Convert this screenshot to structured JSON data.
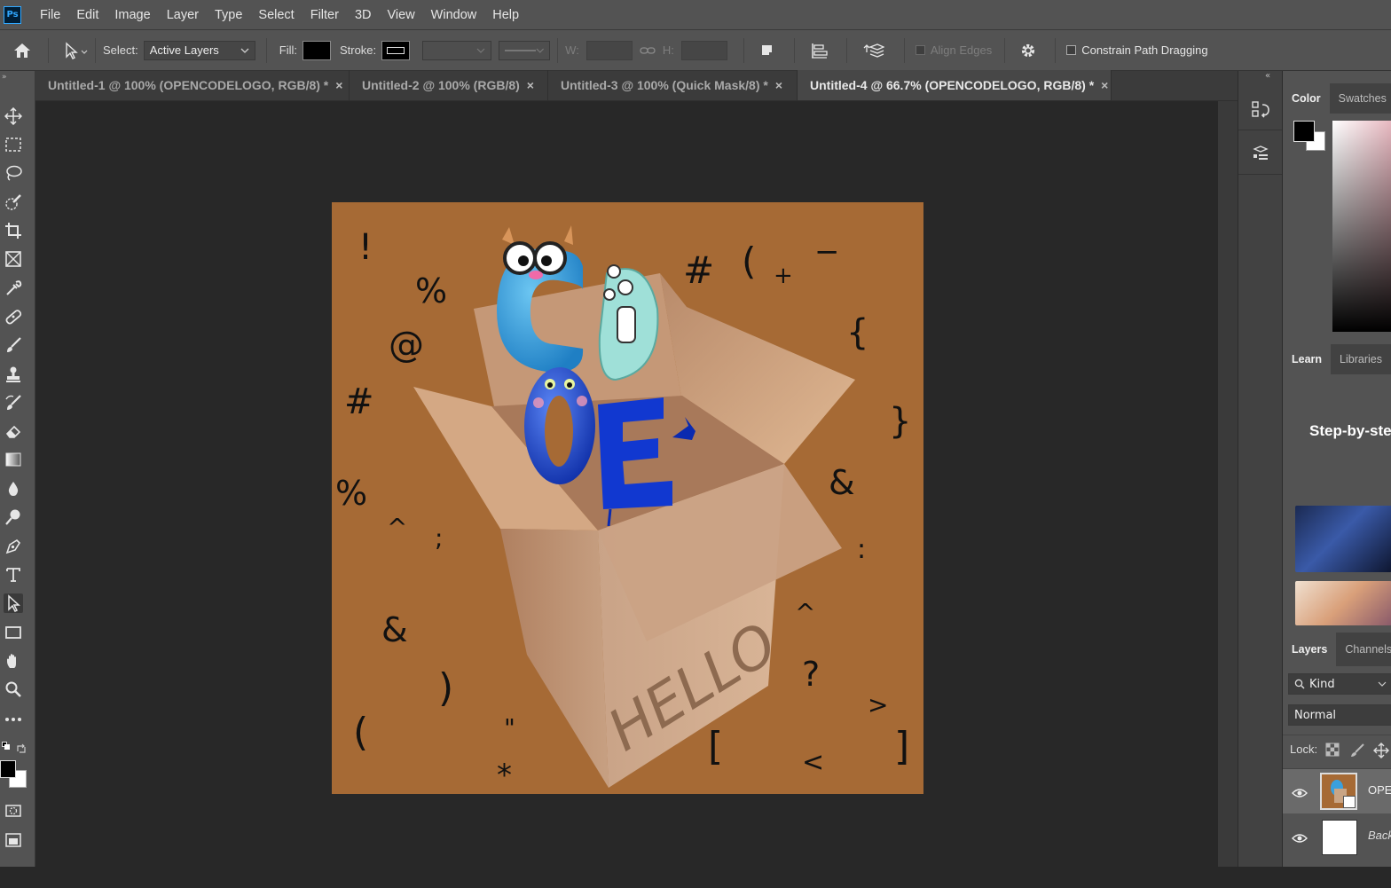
{
  "app": {
    "logo_text": "Ps"
  },
  "menu": [
    "File",
    "Edit",
    "Image",
    "Layer",
    "Type",
    "Select",
    "Filter",
    "3D",
    "View",
    "Window",
    "Help"
  ],
  "options": {
    "select_label": "Select:",
    "select_value": "Active Layers",
    "fill_label": "Fill:",
    "stroke_label": "Stroke:",
    "w_label": "W:",
    "h_label": "H:",
    "align_edges": "Align Edges",
    "constrain": "Constrain Path Dragging"
  },
  "tabs": [
    {
      "label": "Untitled-1 @ 100% (OPENCODELOGO, RGB/8) *",
      "close": "×"
    },
    {
      "label": "Untitled-2 @ 100% (RGB/8)",
      "close": "×"
    },
    {
      "label": "Untitled-3 @ 100% (Quick Mask/8) *",
      "close": "×"
    },
    {
      "label": "Untitled-4 @ 66.7% (OPENCODELOGO, RGB/8) *",
      "close": "×"
    }
  ],
  "canvas": {
    "symbols": [
      "!",
      "%",
      "@",
      "#",
      "%",
      "^",
      ";",
      "&",
      ")",
      "(",
      "\"",
      "*",
      "#",
      "(",
      "+",
      "−",
      "{",
      "}",
      "&",
      ":",
      "^",
      "?",
      ">",
      "[",
      "<",
      "]"
    ],
    "letters": [
      "C",
      "D",
      "O",
      "E"
    ],
    "box_text": "HELLO"
  },
  "panels": {
    "color_tabs": [
      "Color",
      "Swatches"
    ],
    "learn_tabs": [
      "Learn",
      "Libraries"
    ],
    "learn_heading": "Step-by-ste",
    "layers_tabs": [
      "Layers",
      "Channels"
    ],
    "kind_label": "Kind",
    "blend_mode": "Normal",
    "lock_label": "Lock:",
    "layers": [
      {
        "name": "OPEN"
      },
      {
        "name": "Back"
      }
    ]
  },
  "colors": {
    "canvas_bg": "#a66a35",
    "box": "#c9a585",
    "letter_c": "#3aa0dd",
    "letter_o": "#1f4fd6",
    "letter_e": "#1138d0",
    "letter_d": "#9fe0d8"
  }
}
